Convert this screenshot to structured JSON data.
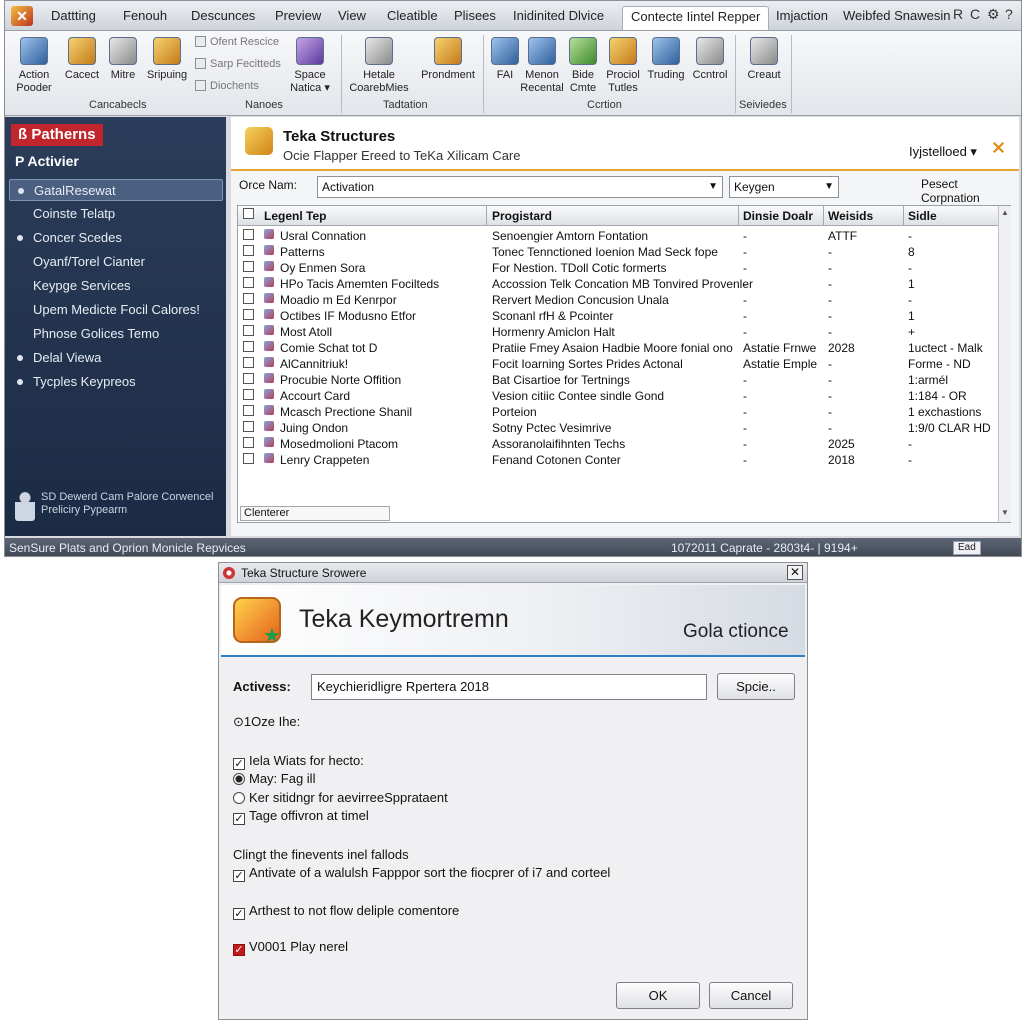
{
  "menubar": {
    "items": [
      "Dattting",
      "Fenouh",
      "Descunces",
      "Preview",
      "View",
      "Cleatible",
      "Plisees",
      "Inidinited Dlvice",
      "Contecte Iintel Repper",
      "Imjaction",
      "Weibfed Snawesin"
    ],
    "window_buttons": [
      "R",
      "C",
      "⚙",
      "?"
    ]
  },
  "ribbon": {
    "buttons": [
      {
        "label": "Action\nPooder",
        "icon": "clipboard-icon"
      },
      {
        "label": "Cacect",
        "icon": "package-icon"
      },
      {
        "label": "Mitre",
        "icon": "pencil-icon"
      },
      {
        "label": "Sripuing",
        "icon": "tools-icon"
      },
      {
        "label": "Space\nNatica ▾",
        "icon": "server-icon"
      },
      {
        "label": "Hetale\nCoarebMies",
        "icon": "document-icon"
      },
      {
        "label": "Prondment",
        "icon": "gears-icon"
      },
      {
        "label": "FAI",
        "icon": "diamond-icon"
      },
      {
        "label": "Menon\nRecental",
        "icon": "report-icon"
      },
      {
        "label": "Bide\nCmte",
        "icon": "globe-icon"
      },
      {
        "label": "Prociol\nTutles",
        "icon": "users-icon"
      },
      {
        "label": "Truding",
        "icon": "chart-icon"
      },
      {
        "label": "Ccntrol",
        "icon": "control-icon"
      },
      {
        "label": "Creaut",
        "icon": "monitor-icon"
      }
    ],
    "small_items": [
      "Ofent Rescice",
      "Sarp Fecitteds",
      "Diochents"
    ],
    "groups": [
      "Cancabecls",
      "Nanoes",
      "Tadtation",
      "Ccrtion",
      "Seiviedes"
    ]
  },
  "sidebar": {
    "brand": "Patherns",
    "subtitle": "P Activier",
    "items": [
      {
        "label": "GatalResewat",
        "bullet": true,
        "selected": true
      },
      {
        "label": "Coinste Telatp",
        "bullet": false
      },
      {
        "label": "Concer Scedes",
        "bullet": true
      },
      {
        "label": "Oyanf/Torel Cianter",
        "bullet": false
      },
      {
        "label": "Keypge Services",
        "bullet": false
      },
      {
        "label": "Upem Medicte Focil Calores!",
        "bullet": false
      },
      {
        "label": "Phnose Golices Temo",
        "bullet": false
      },
      {
        "label": "Delal Viewa",
        "bullet": true
      },
      {
        "label": "Tycples Keypreos",
        "bullet": true
      }
    ],
    "footer": [
      "SD Dewerd Cam Palore Corwencel",
      "Preliciry Pypearm"
    ]
  },
  "main": {
    "title": "Teka Structures",
    "subtitle": "Ocie Flapper Ereed to TeKa Xilicam Care",
    "right_label": "Iyjstelloed ▾",
    "filter": {
      "label": "Orce Nam:",
      "value": "Activation",
      "second": "Keygen",
      "right": "Pesect Corpnation"
    },
    "columns": [
      "Legenl Tep",
      "Progistard",
      "Dinsie Doalr",
      "Weisids",
      "Sidle"
    ],
    "rows": [
      [
        "Usral Connation",
        "Senoengier Amtorn Fontation",
        "-",
        "ATTF",
        "-"
      ],
      [
        "Patterns",
        "Tonec Tennctioned Ioenion Mad Seck fope",
        "-",
        "-",
        "8"
      ],
      [
        "Oy Enmen Sora",
        "For Nestion. TDoll Cotic formerts",
        "-",
        "-",
        "-"
      ],
      [
        "HPo Tacis Amemten Focilteds",
        "Accossion Telk Concation MB Tonvired Provenler",
        "-",
        "-",
        "1"
      ],
      [
        "Moadio m Ed Kenrpor",
        "Rervert Medion Concusion Unala",
        "-",
        "-",
        "-"
      ],
      [
        "Octibes IF Modusno Etfor",
        "Sconanl rfH & Pcointer",
        "-",
        "-",
        "1"
      ],
      [
        "Most Atoll",
        "Hormenry Amiclon Halt",
        "-",
        "-",
        "+"
      ],
      [
        "Comie Schat tot D",
        "Pratiie Fmey Asaion Hadbie Moore fonial ono",
        "Astatie Frnwe",
        "2028",
        "1uctect - Malk"
      ],
      [
        "AlCannitriuk!",
        "Focit Ioarning Sortes Prides Actonal",
        "Astatie Emple",
        "-",
        "Forme - ND"
      ],
      [
        "Procubie Norte Offition",
        "Bat Cisartioe for Tertnings",
        "-",
        "-",
        "1:armél"
      ],
      [
        "Accourt Card",
        "Vesion citiic Contee sindle Gond",
        "-",
        "-",
        "1:184 - OR"
      ],
      [
        "Mcasch Prectione Shanil",
        "Porteion",
        "-",
        "-",
        "1 exchastions"
      ],
      [
        "Juing Ondon",
        "Sotny Pctec Vesimrive",
        "-",
        "-",
        "1:9/0 CLAR HD"
      ],
      [
        "Mosedmolioni Ptacom",
        "Assoranolaifihnten Techs",
        "-",
        "2025",
        "-"
      ],
      [
        "Lenry Crappeten",
        "Fenand Cotonen Conter",
        "-",
        "2018",
        "-"
      ]
    ],
    "footer_tab": "Clenterer"
  },
  "status": {
    "left": "SenSure Plats and Oprion Monicle Repvices",
    "right": "1072011 Caprate  - 2803t4-  |  9194+",
    "zoom": "Ead"
  },
  "dialog": {
    "title": "Teka Structure Srowere",
    "banner": "Teka Keymortremn",
    "banner_right": "Gola ctionce",
    "activation_label": "Activess:",
    "activation_value": "Keychieridligre Rpertera 2018",
    "browse": "Spcie..",
    "option_label": "⊙1Oze Ihe:",
    "options": [
      {
        "kind": "check",
        "checked": true,
        "label": "Iela Wiats for hecto:"
      },
      {
        "kind": "radio",
        "checked": true,
        "label": "May: Fag ill"
      },
      {
        "kind": "radio",
        "checked": false,
        "label": "Ker sitidngr for aevirreeSpprataent"
      },
      {
        "kind": "check",
        "checked": true,
        "label": "Tage offivron at timel"
      }
    ],
    "section_label": "Clingt the finevents inel fallods",
    "options2": [
      {
        "kind": "check",
        "checked": true,
        "label": "Antivate of a walulsh Fapppor sort the fiocprer of i7 and corteel"
      },
      {
        "kind": "check",
        "checked": true,
        "label": "Arthest to not flow deliple comentore"
      },
      {
        "kind": "check-red",
        "checked": true,
        "label": "V0001 Play nerel"
      }
    ],
    "ok": "OK",
    "cancel": "Cancel"
  }
}
